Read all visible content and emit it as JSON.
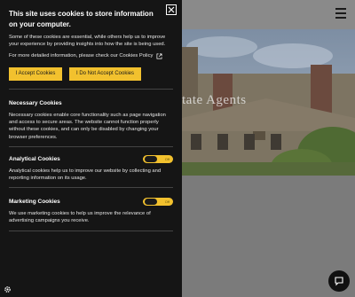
{
  "colors": {
    "accent": "#f2c12e",
    "panel_bg": "#151515"
  },
  "hero": {
    "title_fragment": "tate Agents"
  },
  "cookie": {
    "title": "This site uses cookies to store information on your computer.",
    "intro": "Some of these cookies are essential, while others help us to improve your experience by providing insights into how the site is being used.",
    "policy_text": "For more detailed information, please check our Cookies Policy",
    "accept_label": "I Accept Cookies",
    "reject_label": "I Do Not Accept Cookies",
    "sections": [
      {
        "title": "Necessary Cookies",
        "text": "Necessary cookies enable core functionality such as page navigation and access to secure areas. The website cannot function properly without these cookies, and can only be disabled by changing your browser preferences."
      },
      {
        "title": "Analytical Cookies",
        "toggle": "Off",
        "text": "Analytical cookies help us to improve our website by collecting and reporting information on its usage."
      },
      {
        "title": "Marketing Cookies",
        "toggle": "Off",
        "text": "We use marketing cookies to help us improve the relevance of advertising campaigns you receive."
      }
    ]
  },
  "icons": [
    "close-icon",
    "external-link-icon",
    "menu-icon",
    "chat-icon",
    "settings-gear-icon"
  ]
}
